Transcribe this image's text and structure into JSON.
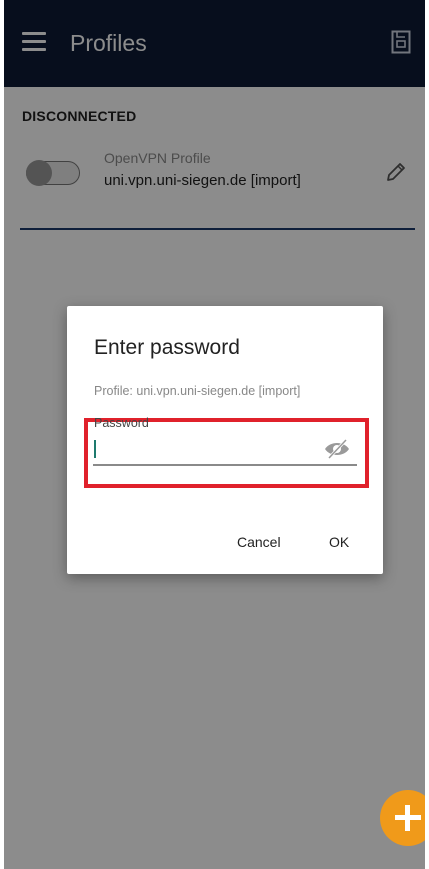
{
  "appbar": {
    "title": "Profiles",
    "menu_icon": "hamburger-menu-icon",
    "import_icon": "import-profile-icon",
    "background_color": "#0d1b36"
  },
  "profiles": {
    "section_header": "DISCONNECTED",
    "items": [
      {
        "type_label": "OpenVPN Profile",
        "name": "uni.vpn.uni-siegen.de [import]",
        "toggle_state": "off",
        "edit_icon": "pencil-icon"
      }
    ]
  },
  "dialog": {
    "title": "Enter password",
    "profile_line": "Profile: uni.vpn.uni-siegen.de [import]",
    "password_label": "Password",
    "password_value": "",
    "visibility_icon": "eye-off-icon",
    "cancel_label": "Cancel",
    "ok_label": "OK",
    "highlight_color": "#e0212b"
  },
  "fab": {
    "icon": "plus-icon",
    "color": "#f09a1a"
  }
}
